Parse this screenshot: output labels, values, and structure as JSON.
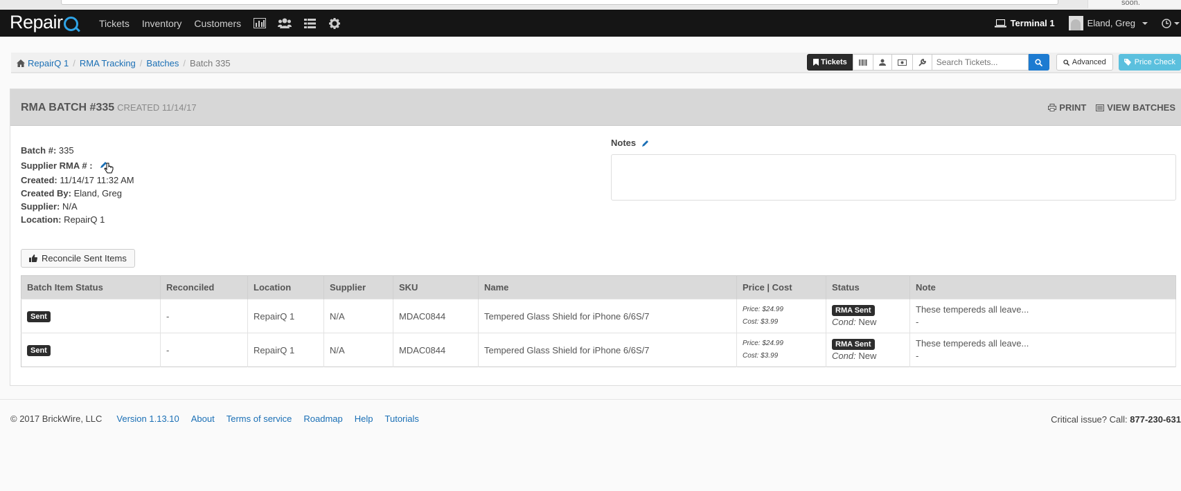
{
  "browser": {
    "toast": "soon."
  },
  "navbar": {
    "brand": "Repair",
    "items": [
      "Tickets",
      "Inventory",
      "Customers"
    ],
    "terminal": "Terminal 1",
    "user": "Eland, Greg"
  },
  "breadcrumb": [
    "RepairQ 1",
    "RMA Tracking",
    "Batches",
    "Batch 335"
  ],
  "toolbar": {
    "tickets_label": "Tickets",
    "search_placeholder": "Search Tickets...",
    "advanced_label": "Advanced",
    "price_check_label": "Price Check"
  },
  "panel": {
    "title": "RMA BATCH #335",
    "created": "CREATED 11/14/17",
    "print_label": "PRINT",
    "view_batches_label": "VIEW BATCHES"
  },
  "details": {
    "batch_label": "Batch #:",
    "batch_value": "335",
    "supplier_rma_label": "Supplier RMA # :",
    "created_label": "Created:",
    "created_value": "11/14/17 11:32 AM",
    "created_by_label": "Created By:",
    "created_by_value": "Eland, Greg",
    "supplier_label": "Supplier:",
    "supplier_value": "N/A",
    "location_label": "Location:",
    "location_value": "RepairQ 1"
  },
  "notes": {
    "label": "Notes"
  },
  "reconcile_label": "Reconcile Sent Items",
  "table": {
    "headers": [
      "Batch Item Status",
      "Reconciled",
      "Location",
      "Supplier",
      "SKU",
      "Name",
      "Price | Cost",
      "Status",
      "Note"
    ],
    "rows": [
      {
        "status": "Sent",
        "reconciled": "-",
        "location": "RepairQ 1",
        "supplier": "N/A",
        "sku": "MDAC0844",
        "name": "Tempered Glass Shield for iPhone 6/6S/7",
        "price": "Price: $24.99",
        "cost": "Cost: $3.99",
        "rma": "RMA Sent",
        "cond_label": "Cond:",
        "cond_value": "New",
        "note": "These tempereds all leave...",
        "note2": "-"
      },
      {
        "status": "Sent",
        "reconciled": "-",
        "location": "RepairQ 1",
        "supplier": "N/A",
        "sku": "MDAC0844",
        "name": "Tempered Glass Shield for iPhone 6/6S/7",
        "price": "Price: $24.99",
        "cost": "Cost: $3.99",
        "rma": "RMA Sent",
        "cond_label": "Cond:",
        "cond_value": "New",
        "note": "These tempereds all leave...",
        "note2": "-"
      }
    ]
  },
  "footer": {
    "copyright": "© 2017 BrickWire, LLC",
    "links": [
      "Version 1.13.10",
      "About",
      "Terms of service",
      "Roadmap",
      "Help",
      "Tutorials"
    ],
    "critical_label": "Critical issue? Call:",
    "phone": "877-230-631"
  }
}
